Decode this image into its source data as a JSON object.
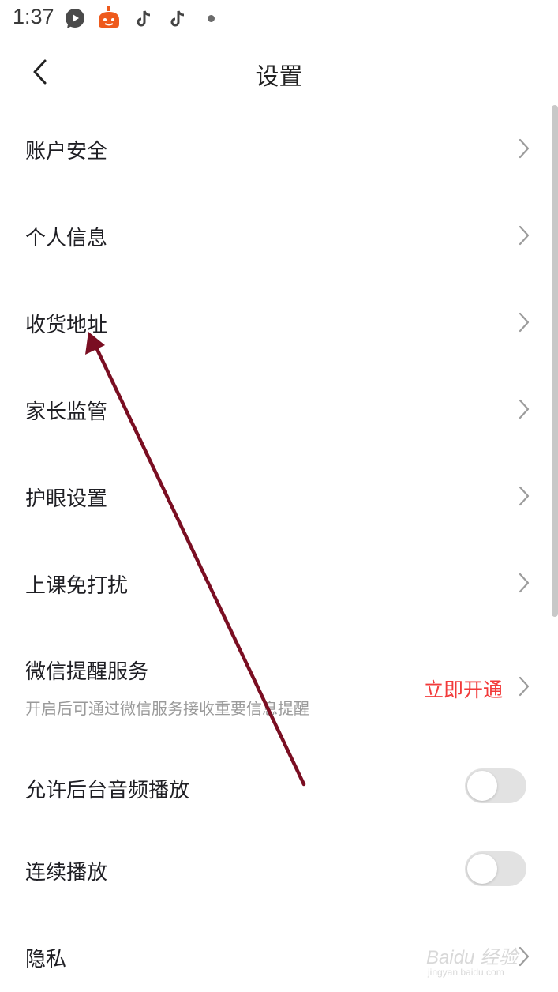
{
  "status_bar": {
    "time": "1:37",
    "icons": [
      "message-icon",
      "app-icon",
      "tiktok-icon",
      "tiktok-icon",
      "dot-icon"
    ]
  },
  "nav": {
    "title": "设置",
    "back_icon": "chevron-left-icon"
  },
  "settings": {
    "items": [
      {
        "label": "账户安全"
      },
      {
        "label": "个人信息"
      },
      {
        "label": "收货地址"
      },
      {
        "label": "家长监管"
      },
      {
        "label": "护眼设置"
      },
      {
        "label": "上课免打扰"
      }
    ],
    "wechat": {
      "label": "微信提醒服务",
      "description": "开启后可通过微信服务接收重要信息提醒",
      "action": "立即开通"
    },
    "toggles": [
      {
        "label": "允许后台音频播放",
        "on": false
      },
      {
        "label": "连续播放",
        "on": false
      }
    ],
    "privacy": {
      "label": "隐私"
    }
  },
  "watermark": {
    "brand": "Baidu 经验",
    "url": "jingyan.baidu.com"
  },
  "colors": {
    "accent_red": "#f23a3a",
    "arrow": "#7a0e22",
    "toggle_off": "#e2e2e2"
  }
}
